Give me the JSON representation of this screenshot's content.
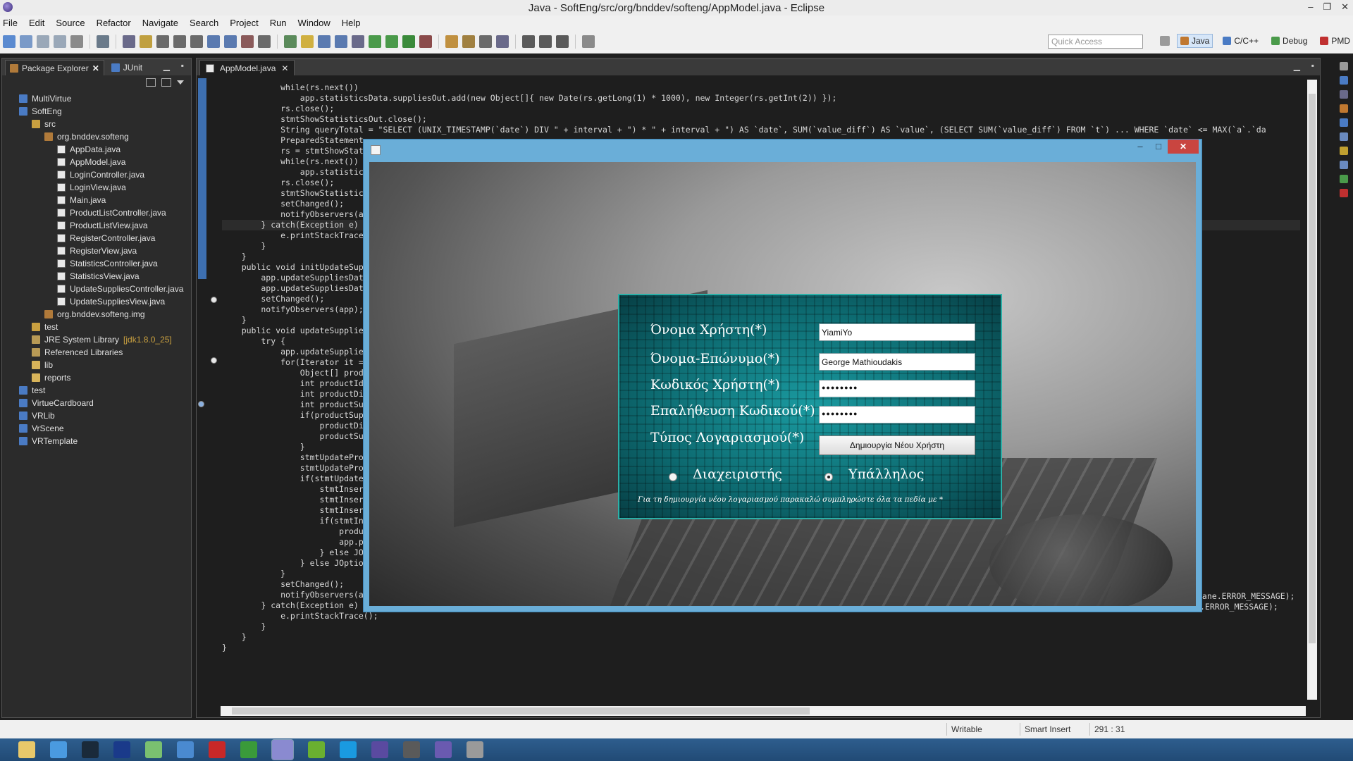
{
  "window": {
    "title": "Java - SoftEng/src/org/bnddev/softeng/AppModel.java - Eclipse",
    "controls": [
      "–",
      "❐",
      "✕"
    ]
  },
  "menu": [
    "File",
    "Edit",
    "Source",
    "Refactor",
    "Navigate",
    "Search",
    "Project",
    "Run",
    "Window",
    "Help"
  ],
  "toolbar": {
    "quick_access_placeholder": "Quick Access",
    "perspectives": [
      {
        "label": "Java",
        "active": true,
        "color": "#c07830"
      },
      {
        "label": "C/C++",
        "active": false,
        "color": "#4a7bc4"
      },
      {
        "label": "Debug",
        "active": false,
        "color": "#4a9a4a"
      },
      {
        "label": "PMD",
        "active": false,
        "color": "#c03030"
      }
    ]
  },
  "left_panel": {
    "tabs": [
      {
        "label": "Package Explorer",
        "active": true,
        "close": "✕"
      },
      {
        "label": "JUnit",
        "active": false,
        "close": ""
      }
    ],
    "tree": [
      {
        "label": "MultiVirtue",
        "depth": 0,
        "icon": "project-icon"
      },
      {
        "label": "SoftEng",
        "depth": 0,
        "icon": "project-icon"
      },
      {
        "label": "src",
        "depth": 1,
        "icon": "src-folder-icon"
      },
      {
        "label": "org.bnddev.softeng",
        "depth": 2,
        "icon": "package-icon"
      },
      {
        "label": "AppData.java",
        "depth": 3,
        "icon": "java-file-icon"
      },
      {
        "label": "AppModel.java",
        "depth": 3,
        "icon": "java-file-icon"
      },
      {
        "label": "LoginController.java",
        "depth": 3,
        "icon": "java-file-icon"
      },
      {
        "label": "LoginView.java",
        "depth": 3,
        "icon": "java-file-icon"
      },
      {
        "label": "Main.java",
        "depth": 3,
        "icon": "java-file-icon"
      },
      {
        "label": "ProductListController.java",
        "depth": 3,
        "icon": "java-file-icon"
      },
      {
        "label": "ProductListView.java",
        "depth": 3,
        "icon": "java-file-icon"
      },
      {
        "label": "RegisterController.java",
        "depth": 3,
        "icon": "java-file-icon"
      },
      {
        "label": "RegisterView.java",
        "depth": 3,
        "icon": "java-file-icon"
      },
      {
        "label": "StatisticsController.java",
        "depth": 3,
        "icon": "java-file-icon"
      },
      {
        "label": "StatisticsView.java",
        "depth": 3,
        "icon": "java-file-icon"
      },
      {
        "label": "UpdateSuppliesController.java",
        "depth": 3,
        "icon": "java-file-icon"
      },
      {
        "label": "UpdateSuppliesView.java",
        "depth": 3,
        "icon": "java-file-icon"
      },
      {
        "label": "org.bnddev.softeng.img",
        "depth": 2,
        "icon": "package-icon"
      },
      {
        "label": "test",
        "depth": 1,
        "icon": "src-folder-icon"
      },
      {
        "label": "JRE System Library",
        "suffix": "[jdk1.8.0_25]",
        "depth": 1,
        "icon": "library-icon"
      },
      {
        "label": "Referenced Libraries",
        "depth": 1,
        "icon": "library-icon"
      },
      {
        "label": "lib",
        "depth": 1,
        "icon": "folder-icon"
      },
      {
        "label": "reports",
        "depth": 1,
        "icon": "folder-icon"
      },
      {
        "label": "test",
        "depth": 0,
        "icon": "project-icon"
      },
      {
        "label": "VirtueCardboard",
        "depth": 0,
        "icon": "project-icon"
      },
      {
        "label": "VRLib",
        "depth": 0,
        "icon": "project-icon"
      },
      {
        "label": "VrScene",
        "depth": 0,
        "icon": "project-icon"
      },
      {
        "label": "VRTemplate",
        "depth": 0,
        "icon": "project-icon"
      }
    ]
  },
  "editor": {
    "tab_label": "AppModel.java",
    "tab_close": "✕",
    "code_lines": [
      "            while(rs.next())",
      "                app.statisticsData.suppliesOut.add(new Object[]{ new Date(rs.getLong(1) * 1000), new Integer(rs.getInt(2)) });",
      "            rs.close();",
      "            stmtShowStatisticsOut.close();",
      "",
      "            String queryTotal = \"SELECT (UNIX_TIMESTAMP(`date`) DIV \" + interval + \") * \" + interval + \") AS `date`, SUM(`value_diff`) AS `value`, (SELECT SUM(`value_diff`) FROM `t`) ... WHERE `date` <= MAX(`a`.`da",
      "            PreparedStatement",
      "            rs = stmtShowStat",
      "            while(rs.next())",
      "                app.statistic",
      "            rs.close();",
      "            stmtShowStatistic",
      "",
      "            setChanged();",
      "            notifyObservers(a",
      "        } catch(Exception e)",
      "            e.printStackTrace",
      "        }",
      "    }",
      "",
      "    public void initUpdateSup",
      "        app.updateSuppliesDat",
      "        app.updateSuppliesDat",
      "        setChanged();",
      "        notifyObservers(app);",
      "    }",
      "",
      "    public void updateSupplie",
      "        try {",
      "            app.updateSupplie",
      "            for(Iterator it =",
      "                Object[] prod",
      "                int productId",
      "                int productDi",
      "                int productSu",
      "                if(productSup",
      "                    productDi",
      "                    productSu",
      "                }",
      "                stmtUpdatePro",
      "                stmtUpdatePro",
      "                if(stmtUpdate",
      "                    stmtInser",
      "                    stmtInser",
      "                    stmtInser",
      "                    if(stmtIn",
      "                        produ",
      "                        app.p",
      "                    } else JO",
      "                } else JOptio",
      "            }",
      "            setChanged();",
      "            notifyObservers(app);",
      "        } catch(Exception e) {",
      "            e.printStackTrace();",
      "        }",
      "    }",
      "}"
    ],
    "tail_1": "Pane.ERROR_MESSAGE);",
    "tail_2": ".ERROR_MESSAGE);"
  },
  "status": {
    "writable": "Writable",
    "insert_mode": "Smart Insert",
    "position": "291 : 31"
  },
  "dialog": {
    "fields": [
      {
        "label": "Όνομα Χρήστη(*)",
        "value": "YiamiYo"
      },
      {
        "label": "Όνομα-Επώνυμο(*)",
        "value": "George Mathioudakis"
      },
      {
        "label": "Κωδικός Χρήστη(*)",
        "value": "●●●●●●●●"
      },
      {
        "label": "Επαλήθευση Κωδικού(*)",
        "value": "●●●●●●●●"
      }
    ],
    "account_type_label": "Τύπος Λογαριασμού(*)",
    "create_button": "Δημιουργία  Νέου Χρήστη",
    "radio_admin": "Διαχειριστής",
    "radio_employee": "Υπάλληλος",
    "selected": "employee",
    "note": "Για τη δημιουργία νέου λογαριασμού παρακαλώ συμπληρώστε όλα τα πεδία με *"
  },
  "taskbar": {
    "apps": [
      "file-explorer-icon",
      "chrome-icon",
      "steam-icon",
      "launcher-icon",
      "notes-icon",
      "keyboard-icon",
      "pdf-icon",
      "app-icon",
      "eclipse-java-icon",
      "android-icon",
      "skype-icon",
      "eclipse-icon",
      "game-icon",
      "eclipse-active-icon",
      "tool-icon"
    ],
    "colors": [
      "#e8c86a",
      "#4a9ae0",
      "#1a2a3a",
      "#1a3a8a",
      "#7ac070",
      "#4a8ad0",
      "#c82828",
      "#3a9a3a",
      "#8a8ad0",
      "#6ab030",
      "#1a9ae0",
      "#5a4aa0",
      "#5a5a5a",
      "#6a5ab0",
      "#9a9a9a"
    ]
  }
}
